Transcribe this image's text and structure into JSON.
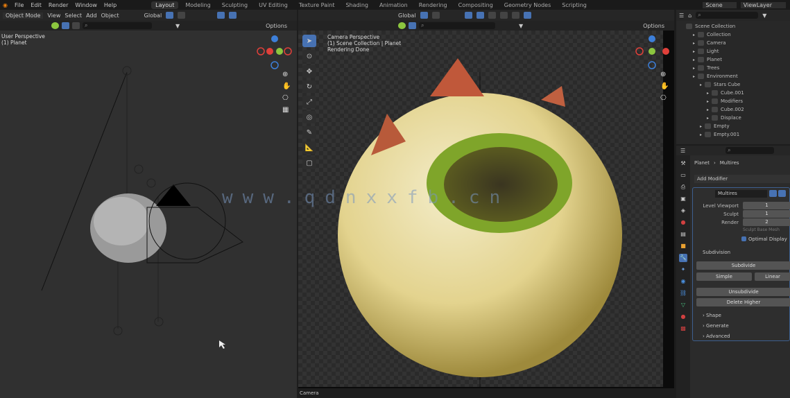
{
  "menu": {
    "items": [
      "File",
      "Edit",
      "Render",
      "Window",
      "Help"
    ],
    "workspaces": [
      "Layout",
      "Modeling",
      "Sculpting",
      "UV Editing",
      "Texture Paint",
      "Shading",
      "Animation",
      "Rendering",
      "Compositing",
      "Geometry Nodes",
      "Scripting"
    ],
    "active_workspace": "Layout",
    "scene": "Scene",
    "view_layer": "ViewLayer"
  },
  "left_viewport": {
    "mode": "Object Mode",
    "menus": [
      "View",
      "Select",
      "Add",
      "Object"
    ],
    "transform": "Global",
    "options": "Options",
    "overlay_title": "User Perspective",
    "overlay_sub": "(1) Planet"
  },
  "right_viewport": {
    "transform": "Global",
    "options": "Options",
    "overlay_title": "Camera Perspective",
    "overlay_sub": "(1) Scene Collection | Planet",
    "overlay_sub2": "Rendering Done",
    "footer": "Camera"
  },
  "outliner": {
    "root": "Scene Collection",
    "items": [
      {
        "label": "Collection",
        "depth": 1
      },
      {
        "label": "Camera",
        "depth": 1
      },
      {
        "label": "Light",
        "depth": 1
      },
      {
        "label": "Planet",
        "depth": 1
      },
      {
        "label": "Trees",
        "depth": 1
      },
      {
        "label": "Environment",
        "depth": 1
      },
      {
        "label": "Stars Cube",
        "depth": 2
      },
      {
        "label": "Cube.001",
        "depth": 3
      },
      {
        "label": "Modifiers",
        "depth": 3
      },
      {
        "label": "Cube.002",
        "depth": 3
      },
      {
        "label": "Displace",
        "depth": 3
      },
      {
        "label": "Empty",
        "depth": 2
      },
      {
        "label": "Empty.001",
        "depth": 2
      }
    ]
  },
  "properties": {
    "breadcrumb_object": "Planet",
    "breadcrumb_modifier": "Multires",
    "add_modifier": "Add Modifier",
    "modifier_name": "Multires",
    "fields": [
      {
        "label": "Level Viewport",
        "value": "1"
      },
      {
        "label": "Sculpt",
        "value": "1"
      },
      {
        "label": "Render",
        "value": "2"
      }
    ],
    "sculpt_base_mesh": "Sculpt Base Mesh",
    "optimal_display": "Optimal Display",
    "subdivision_label": "Subdivision",
    "buttons": {
      "subdivide": "Subdivide",
      "simple": "Simple",
      "linear": "Linear",
      "unsubdivide": "Unsubdivide",
      "delete_higher": "Delete Higher"
    },
    "panels": [
      "Shape",
      "Generate",
      "Advanced"
    ]
  },
  "watermark": "www.qdnxxfb.cn",
  "colors": {
    "accent": "#4772b3",
    "axis_x": "#e0403a",
    "axis_y": "#8cc63f",
    "axis_z": "#3d7fd9",
    "planet": "#e8dca0"
  }
}
